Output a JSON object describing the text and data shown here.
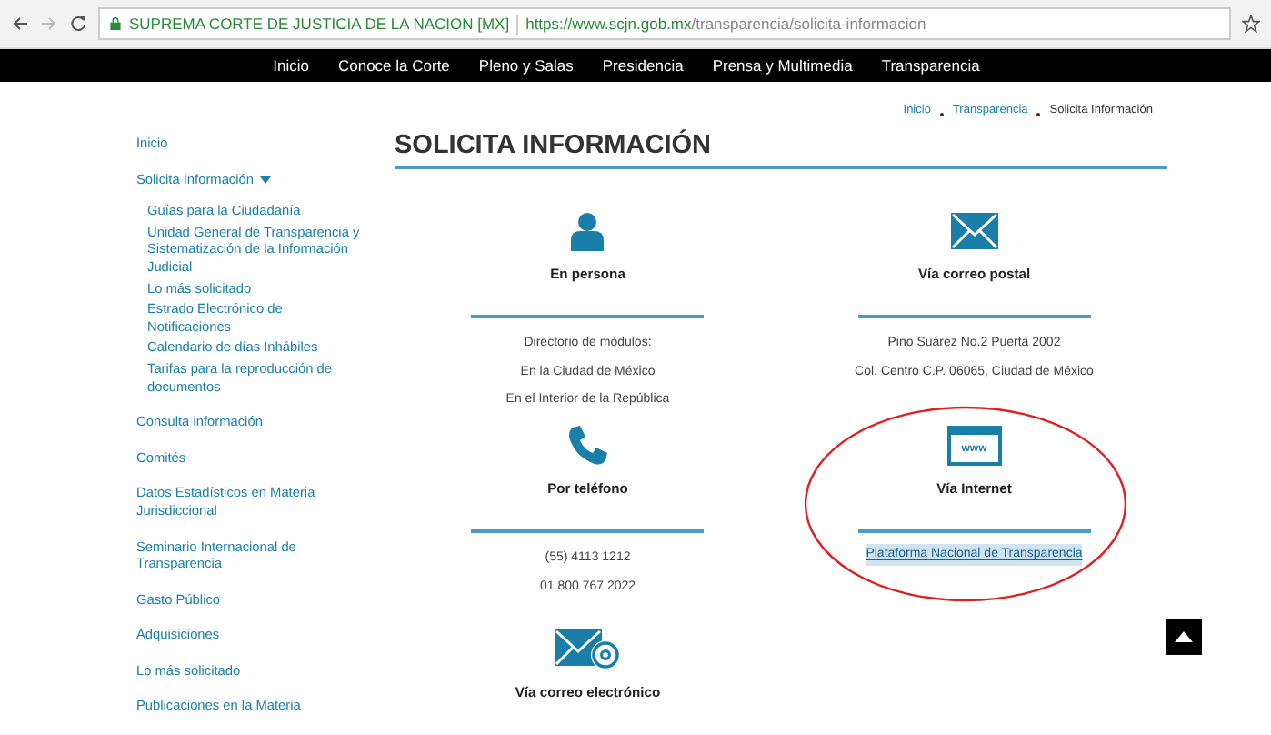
{
  "browser": {
    "site_name": "SUPREMA CORTE DE JUSTICIA DE LA NACION [MX]",
    "url_host": "https://www.scjn.gob.mx",
    "url_path": "/transparencia/solicita-informacion"
  },
  "nav": [
    "Inicio",
    "Conoce la Corte",
    "Pleno y Salas",
    "Presidencia",
    "Prensa y Multimedia",
    "Transparencia"
  ],
  "breadcrumb": [
    {
      "label": "Inicio",
      "current": false
    },
    {
      "label": "Transparencia",
      "current": false
    },
    {
      "label": "Solicita Información",
      "current": true
    }
  ],
  "sidebar": {
    "items": [
      {
        "label": "Inicio"
      },
      {
        "label": "Solicita Información",
        "expanded": true,
        "children": [
          {
            "label": "Guías para la Ciudadanía"
          },
          {
            "label": "Unidad General de Transparencia y Sistematización de la Información Judicial"
          },
          {
            "label": "Lo más solicitado"
          },
          {
            "label": "Estrado Electrónico de Notificaciones"
          },
          {
            "label": "Calendario de días Inhábiles"
          },
          {
            "label": "Tarifas para la reproducción de documentos"
          }
        ]
      },
      {
        "label": "Consulta información"
      },
      {
        "label": "Comités"
      },
      {
        "label": "Datos Estadísticos en Materia Jurisdiccional"
      },
      {
        "label": "Seminario Internacional de Transparencia"
      },
      {
        "label": "Gasto Público"
      },
      {
        "label": "Adquisiciones"
      },
      {
        "label": "Lo más solicitado"
      },
      {
        "label": "Publicaciones en la Materia"
      }
    ]
  },
  "page_title": "SOLICITA INFORMACIÓN",
  "method_rows": [
    {
      "methods": [
        {
          "kind": "person",
          "title": "En persona",
          "lines": [
            {
              "text": "Directorio de módulos:",
              "kind": "text"
            },
            {
              "text": "En la Ciudad de México",
              "kind": "text"
            },
            {
              "text": "En el Interior de la República",
              "kind": "text"
            }
          ],
          "highlighted": false
        },
        {
          "kind": "envelope",
          "title": "Vía correo postal",
          "lines": [
            {
              "text": "Pino Suárez No.2 Puerta 2002",
              "kind": "text"
            },
            {
              "text": "Col. Centro C.P. 06065, Ciudad de México",
              "kind": "text"
            }
          ],
          "highlighted": false
        }
      ]
    },
    {
      "methods": [
        {
          "kind": "phone",
          "title": "Por teléfono",
          "lines": [
            {
              "text": "(55) 4113 1212",
              "kind": "text"
            },
            {
              "text": "01 800 767 2022",
              "kind": "text"
            }
          ],
          "highlighted": false
        },
        {
          "kind": "web",
          "icon_text": "www",
          "title": "Vía Internet",
          "lines": [
            {
              "text": "Plataforma Nacional de Transparencia",
              "kind": "link"
            }
          ],
          "highlighted": true
        }
      ]
    },
    {
      "methods": [
        {
          "kind": "email",
          "title": "Vía correo electrónico",
          "highlighted": false
        }
      ]
    }
  ]
}
